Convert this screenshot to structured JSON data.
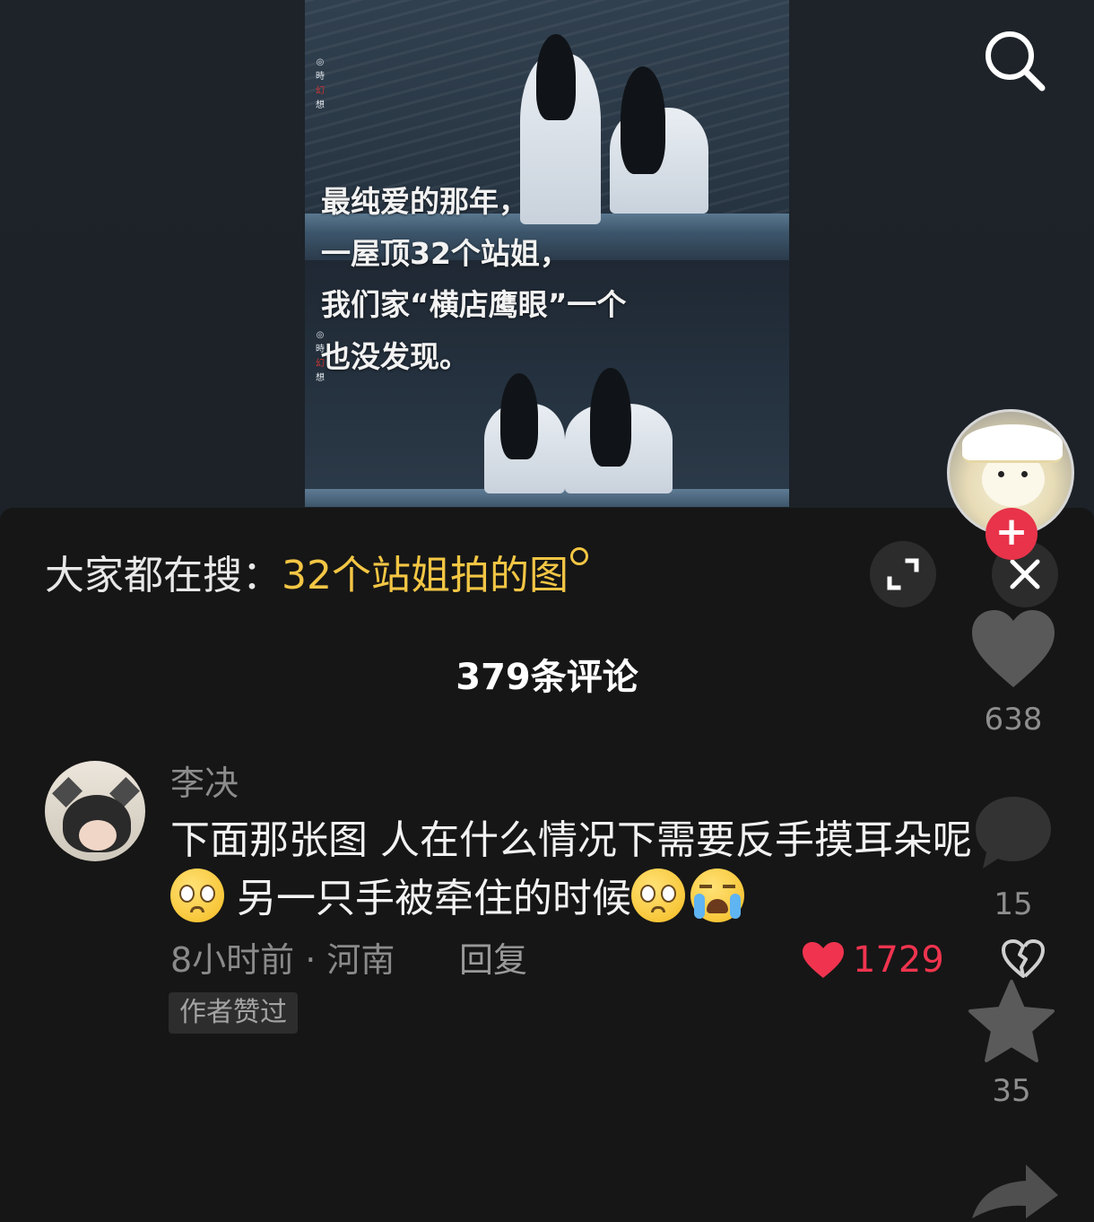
{
  "video": {
    "caption_lines": [
      "最纯爱的那年，",
      "一屋顶32个站姐，",
      "我们家“横店鹰眼”一个",
      "也没发现。"
    ],
    "watermark_top": [
      "時",
      "幻",
      "想"
    ],
    "watermark_bottom": [
      "時",
      "幻",
      "想"
    ]
  },
  "top_bar": {
    "search_icon": "search-icon"
  },
  "hot_search": {
    "lead": "大家都在搜：",
    "term": "32个站姐拍的图"
  },
  "comments": {
    "count_label": "379条评论",
    "items": [
      {
        "user": "李决",
        "text_line1": "下面那张图  人在什么情况下需要反手摸耳朵呢",
        "text_line2_a": "另一只手被牵住的时候",
        "emojis": [
          "pleading-face-emoji",
          "pleading-face-emoji",
          "loudly-crying-face-emoji"
        ],
        "time_location": "8小时前 · 河南",
        "reply_label": "回复",
        "likes": "1729",
        "badge": "作者赞过"
      }
    ]
  },
  "side_actions": {
    "like_count": "638",
    "comment_count": "15",
    "favorite_count": "35"
  },
  "colors": {
    "accent_search_term": "#f3c644",
    "like_red": "#f0344f",
    "follow_red": "#e8334a",
    "background": "#161616"
  }
}
